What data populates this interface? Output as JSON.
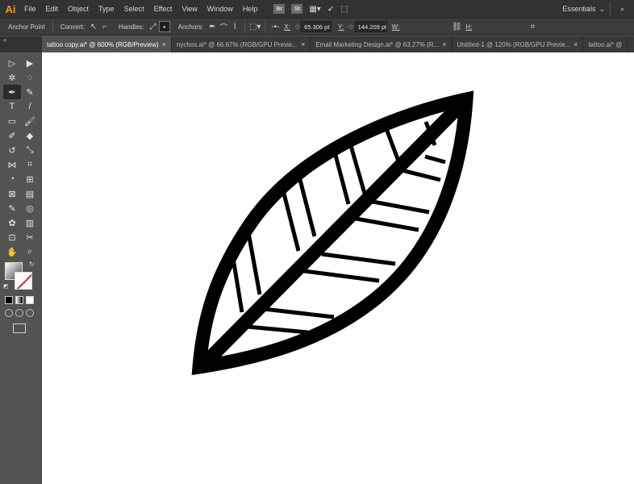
{
  "app": {
    "logo": "Ai"
  },
  "menu": {
    "items": [
      "File",
      "Edit",
      "Object",
      "Type",
      "Select",
      "Effect",
      "View",
      "Window",
      "Help"
    ],
    "icons": [
      "bridge-icon",
      "stock-icon",
      "arrange-documents-icon",
      "send-icon",
      "brush-icon"
    ],
    "bridge_label": "Br",
    "stock_label": "St",
    "workspace": "Essentials"
  },
  "controlbar": {
    "tool_name": "Anchor Point",
    "convert_label": "Convert:",
    "handles_label": "Handles:",
    "anchors_label": "Anchors:",
    "x_label": "X:",
    "x_value": "65.306 pt",
    "y_label": "Y:",
    "y_value": "144.209 pt",
    "w_label": "W:",
    "h_label": "H:"
  },
  "tabs": [
    {
      "label": "tattoo copy.ai* @ 600% (RGB/Preview)",
      "active": true
    },
    {
      "label": "nychos.ai* @ 66.67% (RGB/GPU Previe...",
      "active": false
    },
    {
      "label": "Email Marketing Design.ai* @ 63.27% (R...",
      "active": false
    },
    {
      "label": "Untitled-1 @ 120% (RGB/GPU Previe...",
      "active": false
    },
    {
      "label": "tattoo.ai* @",
      "active": false
    }
  ],
  "tools": [
    "selection-icon",
    "direct-selection-icon",
    "magic-wand-icon",
    "lasso-icon",
    "pen-icon",
    "curvature-icon",
    "type-icon",
    "line-segment-icon",
    "rectangle-icon",
    "paintbrush-icon",
    "shaper-icon",
    "eraser-icon",
    "rotate-icon",
    "scale-icon",
    "width-icon",
    "free-transform-icon",
    "shape-builder-icon",
    "perspective-grid-icon",
    "mesh-icon",
    "gradient-icon",
    "eyedropper-icon",
    "blend-icon",
    "symbol-sprayer-icon",
    "column-graph-icon",
    "artboard-icon",
    "slice-icon",
    "hand-icon",
    "zoom-icon"
  ],
  "tool_glyphs": [
    "▷",
    "▶",
    "✲",
    "◌",
    "✒",
    "✎",
    "T",
    "/",
    "▭",
    "🖌",
    "✐",
    "◆",
    "↺",
    "⤡",
    "⋈",
    "⌗",
    "◔",
    "⊞",
    "⊠",
    "▤",
    "✎",
    "◎",
    "✿",
    "▥",
    "⊡",
    "✂",
    "✋",
    "⌕"
  ],
  "colors": {
    "menubar": "#323232",
    "controlbar": "#3c3c3c",
    "panel": "#535353",
    "canvas": "#ffffff",
    "artwork": "#000000",
    "logo": "#ff9a00",
    "none_slash": "#e02020"
  }
}
